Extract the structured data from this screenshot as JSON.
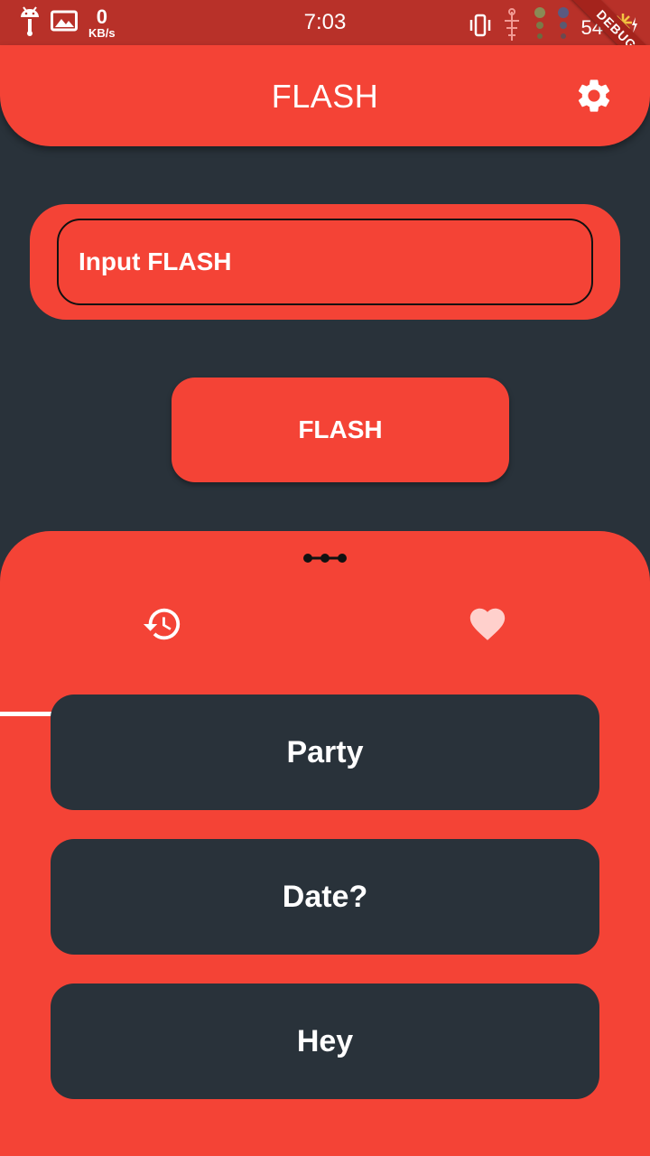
{
  "status_bar": {
    "time": "7:03",
    "net_speed_value": "0",
    "net_speed_unit": "KB/s",
    "battery": "54",
    "debug_label": "DEBUG",
    "icons": [
      "android-icon",
      "image-icon",
      "vibrate-icon",
      "wifi-icon",
      "battery-charging-icon"
    ]
  },
  "app_bar": {
    "title": "FLASH",
    "settings_icon": "gear-icon"
  },
  "input": {
    "placeholder": "Input FLASH",
    "value": ""
  },
  "flash_button": {
    "label": "FLASH"
  },
  "sheet": {
    "tabs": [
      {
        "icon": "history-icon",
        "selected": true
      },
      {
        "icon": "heart-icon",
        "selected": false
      }
    ],
    "items": [
      "Party",
      "Date?",
      "Hey"
    ]
  },
  "colors": {
    "primary": "#f44336",
    "status_bar": "#b83129",
    "background": "#29323a",
    "text": "#ffffff"
  }
}
